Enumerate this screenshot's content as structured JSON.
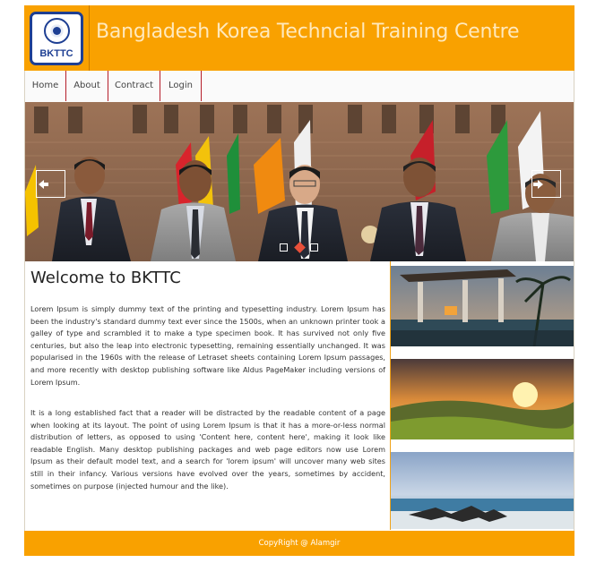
{
  "header": {
    "logo_text": "BKTTC",
    "title": "Bangladesh Korea Techncial Training Centre"
  },
  "nav": {
    "items": [
      {
        "label": "Home"
      },
      {
        "label": "About"
      },
      {
        "label": "Contract"
      },
      {
        "label": "Login"
      }
    ]
  },
  "slider": {
    "prev_icon": "arrow-left-icon",
    "next_icon": "arrow-right-icon",
    "slide_count": 3,
    "active_slide": 2
  },
  "main": {
    "heading": "Welcome to BKTTC",
    "paragraphs": [
      "Lorem Ipsum is simply dummy text of the printing and typesetting industry. Lorem Ipsum has been the industry's standard dummy text ever since the 1500s, when an unknown printer took a galley of type and scrambled it to make a type specimen book. It has survived not only five centuries, but also the leap into electronic typesetting, remaining essentially unchanged. It was popularised in the 1960s with the release of Letraset sheets containing Lorem Ipsum passages, and more recently with desktop publishing software like Aldus PageMaker including versions of Lorem Ipsum.",
      "It is a long established fact that a reader will be distracted by the readable content of a page when looking at its layout. The point of using Lorem Ipsum is that it has a more-or-less normal distribution of letters, as opposed to using 'Content here, content here', making it look like readable English. Many desktop publishing packages and web page editors now use Lorem Ipsum as their default model text, and a search for 'lorem ipsum' will uncover many web sites still in their infancy. Various versions have evolved over the years, sometimes by accident, sometimes on purpose (injected humour and the like)."
    ]
  },
  "footer": {
    "text": "CopyRight @ Alamgir"
  },
  "colors": {
    "brand_orange": "#f9a100",
    "logo_blue": "#1e3f93",
    "nav_divider": "#b51f2b"
  }
}
